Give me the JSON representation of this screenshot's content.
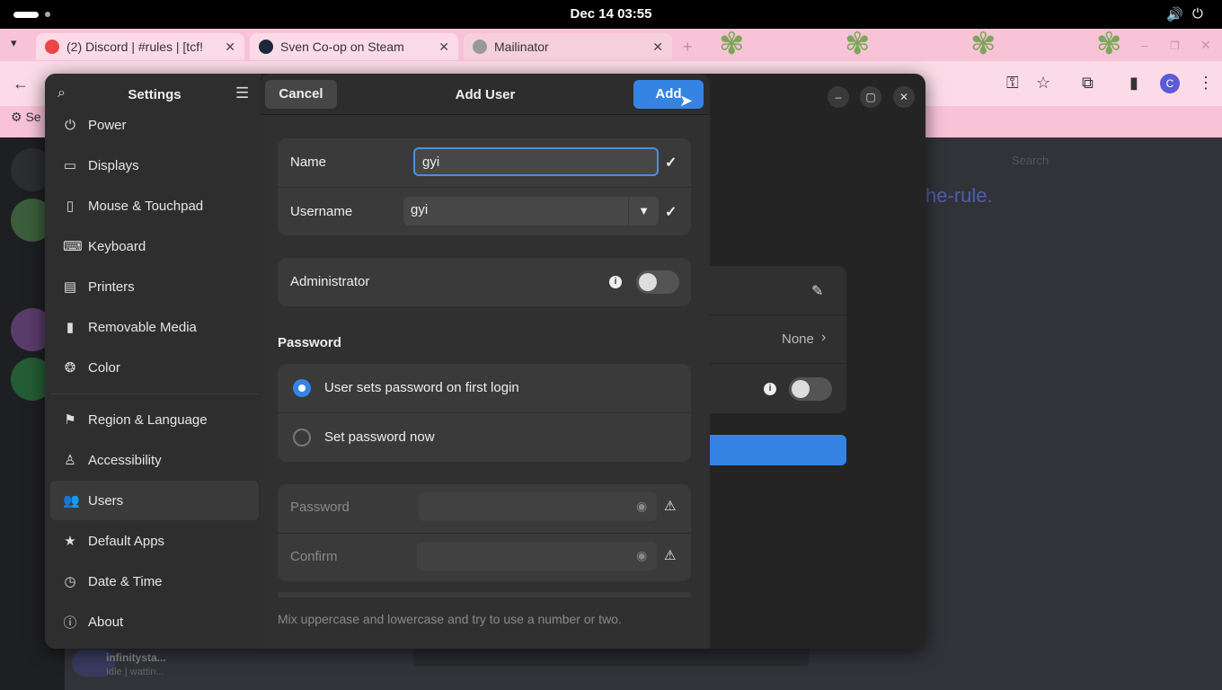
{
  "topbar": {
    "clock": "Dec 14  03:55"
  },
  "browser": {
    "tabs": [
      {
        "label": "(2) Discord | #rules | [tcf!",
        "close": "✕"
      },
      {
        "label": "Sven Co-op on Steam",
        "close": "✕"
      },
      {
        "label": "Mailinator",
        "close": "✕"
      }
    ],
    "new_tab": "+",
    "profile_initial": "C",
    "bookmark_partial": "Se"
  },
  "discord": {
    "bg_text": "he-rule.",
    "search": "Search",
    "user_name": "infinitysta...",
    "user_status": "Idle | wattin..."
  },
  "settings": {
    "title": "Settings",
    "nav": [
      {
        "label": "Power",
        "icon": "power-icon"
      },
      {
        "label": "Displays",
        "icon": "display-icon"
      },
      {
        "label": "Mouse & Touchpad",
        "icon": "mouse-icon"
      },
      {
        "label": "Keyboard",
        "icon": "keyboard-icon"
      },
      {
        "label": "Printers",
        "icon": "printer-icon"
      },
      {
        "label": "Removable Media",
        "icon": "usb-icon"
      },
      {
        "label": "Color",
        "icon": "color-icon"
      },
      {
        "label": "Region & Language",
        "icon": "flag-icon"
      },
      {
        "label": "Accessibility",
        "icon": "accessibility-icon"
      },
      {
        "label": "Users",
        "icon": "users-icon"
      },
      {
        "label": "Default Apps",
        "icon": "star-icon"
      },
      {
        "label": "Date & Time",
        "icon": "clock-icon"
      },
      {
        "label": "About",
        "icon": "info-icon"
      }
    ],
    "users_page": {
      "autologin_value": "None"
    }
  },
  "dialog": {
    "title": "Add User",
    "cancel_label": "Cancel",
    "add_label": "Add",
    "name_label": "Name",
    "name_value": "gyi",
    "username_label": "Username",
    "username_value": "gyi",
    "admin_label": "Administrator",
    "admin_enabled": false,
    "password_section": "Password",
    "password_options": [
      {
        "label": "User sets password on first login",
        "selected": true
      },
      {
        "label": "Set password now",
        "selected": false
      }
    ],
    "password_label": "Password",
    "confirm_label": "Confirm",
    "hint": "Mix uppercase and lowercase and try to use a number or two."
  },
  "colors": {
    "accent": "#3584e4",
    "dialog_bg": "#303030",
    "sidebar_bg": "#2e2e2e"
  }
}
